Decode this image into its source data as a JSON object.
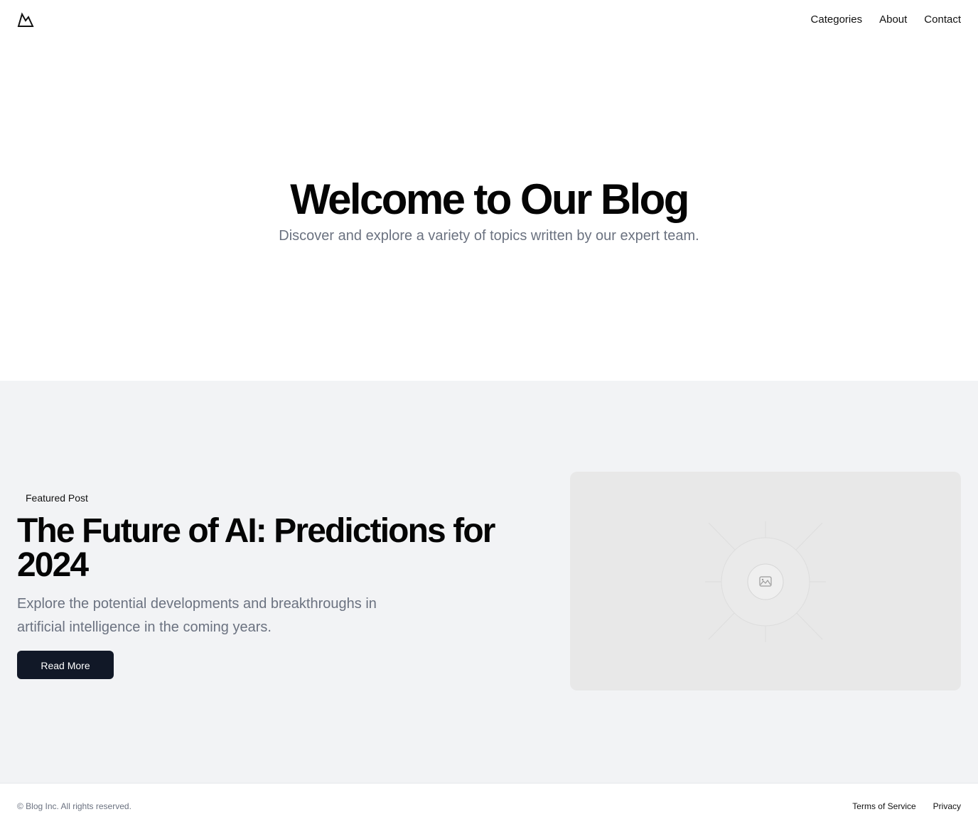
{
  "header": {
    "logo_icon": "mountain-icon",
    "nav": [
      {
        "label": "Categories"
      },
      {
        "label": "About"
      },
      {
        "label": "Contact"
      }
    ]
  },
  "hero": {
    "title": "Welcome to Our Blog",
    "subtitle": "Discover and explore a variety of topics written by our expert team."
  },
  "featured": {
    "badge": "Featured Post",
    "title": "The Future of AI: Predictions for 2024",
    "description": "Explore the potential developments and breakthroughs in artificial intelligence in the coming years.",
    "button_label": "Read More",
    "image_icon": "image-placeholder-icon"
  },
  "footer": {
    "copyright": "© Blog Inc. All rights reserved.",
    "links": [
      {
        "label": "Terms of Service"
      },
      {
        "label": "Privacy"
      }
    ]
  },
  "colors": {
    "primary_button": "#111827",
    "muted_text": "#6b7280",
    "section_background": "#f2f3f5"
  }
}
